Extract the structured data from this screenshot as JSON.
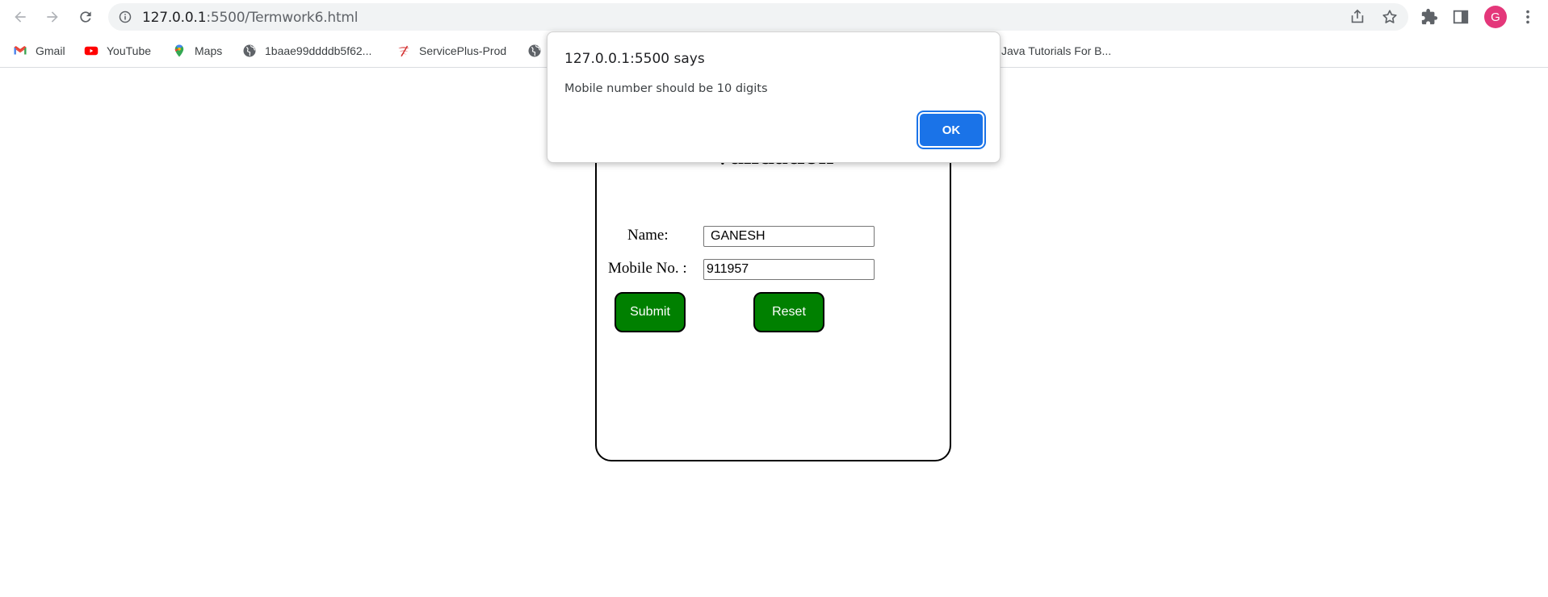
{
  "browser": {
    "url_host": "127.0.0.1",
    "url_rest": ":5500/Termwork6.html",
    "avatar_letter": "G",
    "bookmarks": [
      {
        "label": "Gmail",
        "icon": "gmail-icon"
      },
      {
        "label": "YouTube",
        "icon": "youtube-icon"
      },
      {
        "label": "Maps",
        "icon": "maps-icon"
      },
      {
        "label": "1baae99ddddb5f62...",
        "icon": "globe-icon"
      },
      {
        "label": "ServicePlus-Prod",
        "icon": "serviceplus-icon"
      },
      {
        "label": "",
        "icon": "globe-icon"
      },
      {
        "label": "Java Tutorials For B...",
        "icon": ""
      }
    ]
  },
  "form": {
    "heading_visible_fragment": "Validation",
    "name_label": "Name:",
    "name_value": "GANESH",
    "mobile_label": "Mobile No. :",
    "mobile_value": "911957",
    "submit_label": "Submit",
    "reset_label": "Reset",
    "button_color": "#008000"
  },
  "alert": {
    "title": "127.0.0.1:5500 says",
    "message": "Mobile number should be 10 digits",
    "ok_label": "OK",
    "ok_color": "#1a73e8"
  }
}
